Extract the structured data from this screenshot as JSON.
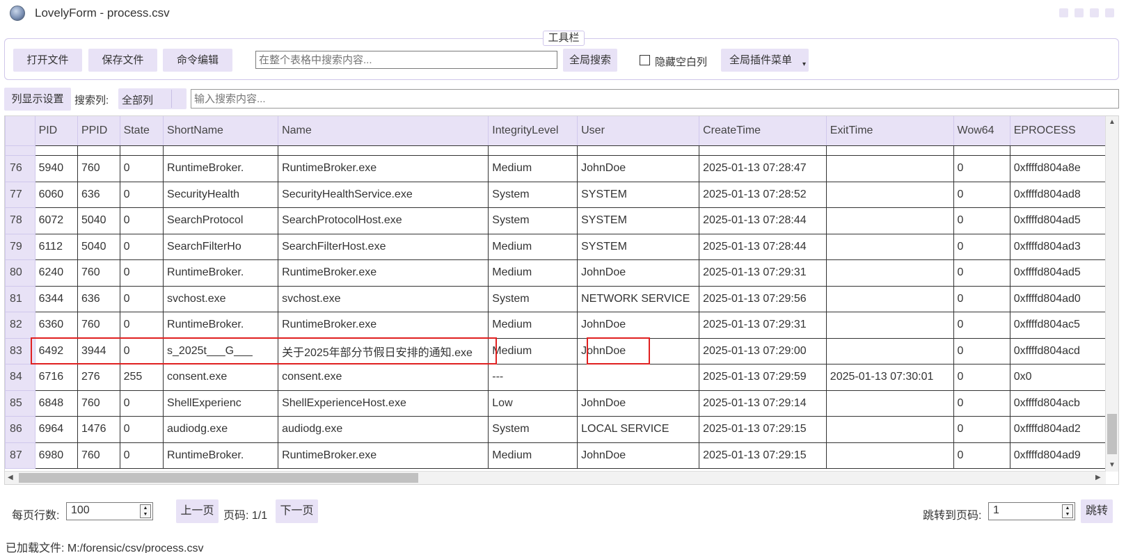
{
  "window": {
    "title": "LovelyForm - process.csv"
  },
  "toolbar": {
    "legend": "工具栏",
    "open_file": "打开文件",
    "save_file": "保存文件",
    "command_edit": "命令编辑",
    "search_placeholder": "在整个表格中搜索内容...",
    "global_search": "全局搜索",
    "hide_empty_cols": "隐藏空白列",
    "plugin_menu": "全局插件菜单"
  },
  "filter": {
    "column_settings": "列显示设置",
    "search_col_label": "搜索列:",
    "search_col_value": "全部列",
    "search_placeholder": "输入搜索内容..."
  },
  "table": {
    "columns": [
      "PID",
      "PPID",
      "State",
      "ShortName",
      "Name",
      "IntegrityLevel",
      "User",
      "CreateTime",
      "ExitTime",
      "Wow64",
      "EPROCESS"
    ],
    "rows": [
      {
        "n": "76",
        "cells": [
          "5940",
          "760",
          "0",
          "RuntimeBroker.",
          "RuntimeBroker.exe",
          "Medium",
          "JohnDoe",
          "2025-01-13 07:28:47",
          "",
          "0",
          "0xffffd804a8e"
        ]
      },
      {
        "n": "77",
        "cells": [
          "6060",
          "636",
          "0",
          "SecurityHealth",
          "SecurityHealthService.exe",
          "System",
          "SYSTEM",
          "2025-01-13 07:28:52",
          "",
          "0",
          "0xffffd804ad8"
        ]
      },
      {
        "n": "78",
        "cells": [
          "6072",
          "5040",
          "0",
          "SearchProtocol",
          "SearchProtocolHost.exe",
          "System",
          "SYSTEM",
          "2025-01-13 07:28:44",
          "",
          "0",
          "0xffffd804ad5"
        ]
      },
      {
        "n": "79",
        "cells": [
          "6112",
          "5040",
          "0",
          "SearchFilterHo",
          "SearchFilterHost.exe",
          "Medium",
          "SYSTEM",
          "2025-01-13 07:28:44",
          "",
          "0",
          "0xffffd804ad3"
        ]
      },
      {
        "n": "80",
        "cells": [
          "6240",
          "760",
          "0",
          "RuntimeBroker.",
          "RuntimeBroker.exe",
          "Medium",
          "JohnDoe",
          "2025-01-13 07:29:31",
          "",
          "0",
          "0xffffd804ad5"
        ]
      },
      {
        "n": "81",
        "cells": [
          "6344",
          "636",
          "0",
          "svchost.exe",
          "svchost.exe",
          "System",
          "NETWORK SERVICE",
          "2025-01-13 07:29:56",
          "",
          "0",
          "0xffffd804ad0"
        ]
      },
      {
        "n": "82",
        "cells": [
          "6360",
          "760",
          "0",
          "RuntimeBroker.",
          "RuntimeBroker.exe",
          "Medium",
          "JohnDoe",
          "2025-01-13 07:29:31",
          "",
          "0",
          "0xffffd804ac5"
        ]
      },
      {
        "n": "83",
        "cells": [
          "6492",
          "3944",
          "0",
          "s_2025t___G___",
          "关于2025年部分节假日安排的通知.exe",
          "Medium",
          "JohnDoe",
          "2025-01-13 07:29:00",
          "",
          "0",
          "0xffffd804acd"
        ]
      },
      {
        "n": "84",
        "cells": [
          "6716",
          "276",
          "255",
          "consent.exe",
          "consent.exe",
          "---",
          "",
          "2025-01-13 07:29:59",
          "2025-01-13 07:30:01",
          "0",
          "0x0"
        ]
      },
      {
        "n": "85",
        "cells": [
          "6848",
          "760",
          "0",
          "ShellExperienc",
          "ShellExperienceHost.exe",
          "Low",
          "JohnDoe",
          "2025-01-13 07:29:14",
          "",
          "0",
          "0xffffd804acb"
        ]
      },
      {
        "n": "86",
        "cells": [
          "6964",
          "1476",
          "0",
          "audiodg.exe",
          "audiodg.exe",
          "System",
          "LOCAL SERVICE",
          "2025-01-13 07:29:15",
          "",
          "0",
          "0xffffd804ad2"
        ]
      },
      {
        "n": "87",
        "cells": [
          "6980",
          "760",
          "0",
          "RuntimeBroker.",
          "RuntimeBroker.exe",
          "Medium",
          "JohnDoe",
          "2025-01-13 07:29:15",
          "",
          "0",
          "0xffffd804ad9"
        ]
      }
    ]
  },
  "pagination": {
    "rows_per_page_label": "每页行数:",
    "rows_per_page": "100",
    "prev": "上一页",
    "page_info": "页码: 1/1",
    "next": "下一页",
    "jump_label": "跳转到页码:",
    "jump_value": "1",
    "jump": "跳转"
  },
  "status": {
    "loaded_file": "已加载文件: M:/forensic/csv/process.csv"
  },
  "colors": {
    "accent": "#e8e2f6",
    "highlight": "#e02020"
  }
}
